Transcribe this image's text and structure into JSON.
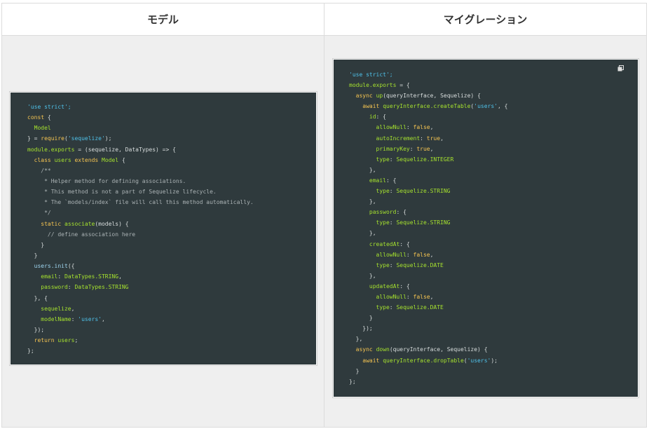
{
  "headers": {
    "model": "モデル",
    "migration": "マイグレーション"
  },
  "icons": {
    "copy": "copy-icon"
  },
  "colors": {
    "code_bg": "#2f3a3d",
    "string": "#4fc1e9",
    "keyword": "#f5c451",
    "attribute": "#a6e22e",
    "comment": "#aab2b4"
  },
  "model_code": [
    [
      [
        "str",
        "'use strict';"
      ]
    ],
    [
      [
        "kw",
        "const"
      ],
      [
        "pl",
        " {"
      ]
    ],
    [
      [
        "pl",
        "  "
      ],
      [
        "attr",
        "Model"
      ]
    ],
    [
      [
        "pl",
        "} = "
      ],
      [
        "kw",
        "require"
      ],
      [
        "pl",
        "("
      ],
      [
        "str",
        "'sequelize'"
      ],
      [
        "pl",
        ");"
      ]
    ],
    [
      [
        "attr",
        "module.exports"
      ],
      [
        "pl",
        " = (sequelize, DataTypes) => {"
      ]
    ],
    [
      [
        "pl",
        "  "
      ],
      [
        "kw",
        "class"
      ],
      [
        "pl",
        " "
      ],
      [
        "attr",
        "users"
      ],
      [
        "pl",
        " "
      ],
      [
        "kw",
        "extends"
      ],
      [
        "pl",
        " "
      ],
      [
        "attr",
        "Model"
      ],
      [
        "pl",
        " {"
      ]
    ],
    [
      [
        "cm",
        "    /**"
      ]
    ],
    [
      [
        "cm",
        "     * Helper method for defining associations."
      ]
    ],
    [
      [
        "cm",
        "     * This method is not a part of Sequelize lifecycle."
      ]
    ],
    [
      [
        "cm",
        "     * The `models/index` file will call this method automatically."
      ]
    ],
    [
      [
        "cm",
        "     */"
      ]
    ],
    [
      [
        "pl",
        "    "
      ],
      [
        "kw",
        "static"
      ],
      [
        "pl",
        " "
      ],
      [
        "attr",
        "associate"
      ],
      [
        "pl",
        "(models) {"
      ]
    ],
    [
      [
        "cm",
        "      // define association here"
      ]
    ],
    [
      [
        "pl",
        "    }"
      ]
    ],
    [
      [
        "pl",
        "  }"
      ]
    ],
    [
      [
        "pl",
        "  "
      ],
      [
        "fn",
        "users.init"
      ],
      [
        "pl",
        "({"
      ]
    ],
    [
      [
        "pl",
        "    "
      ],
      [
        "attr",
        "email"
      ],
      [
        "pl",
        ": "
      ],
      [
        "attr",
        "DataTypes.STRING"
      ],
      [
        "pl",
        ","
      ]
    ],
    [
      [
        "pl",
        "    "
      ],
      [
        "attr",
        "password"
      ],
      [
        "pl",
        ": "
      ],
      [
        "attr",
        "DataTypes.STRING"
      ]
    ],
    [
      [
        "pl",
        "  }, {"
      ]
    ],
    [
      [
        "pl",
        "    "
      ],
      [
        "attr",
        "sequelize"
      ],
      [
        "pl",
        ","
      ]
    ],
    [
      [
        "pl",
        "    "
      ],
      [
        "attr",
        "modelName"
      ],
      [
        "pl",
        ": "
      ],
      [
        "str",
        "'users'"
      ],
      [
        "pl",
        ","
      ]
    ],
    [
      [
        "pl",
        "  });"
      ]
    ],
    [
      [
        "pl",
        "  "
      ],
      [
        "kw",
        "return"
      ],
      [
        "pl",
        " "
      ],
      [
        "attr",
        "users"
      ],
      [
        "pl",
        ";"
      ]
    ],
    [
      [
        "pl",
        "};"
      ]
    ]
  ],
  "migration_code": [
    [
      [
        "str",
        "'use strict';"
      ]
    ],
    [
      [
        "attr",
        "module.exports"
      ],
      [
        "pl",
        " = {"
      ]
    ],
    [
      [
        "pl",
        "  "
      ],
      [
        "kw",
        "async"
      ],
      [
        "pl",
        " "
      ],
      [
        "attr",
        "up"
      ],
      [
        "pl",
        "(queryInterface, Sequelize) {"
      ]
    ],
    [
      [
        "pl",
        "    "
      ],
      [
        "kw",
        "await"
      ],
      [
        "pl",
        " "
      ],
      [
        "attr",
        "queryInterface.createTable"
      ],
      [
        "pl",
        "("
      ],
      [
        "str",
        "'users'"
      ],
      [
        "pl",
        ", {"
      ]
    ],
    [
      [
        "pl",
        "      "
      ],
      [
        "attr",
        "id"
      ],
      [
        "pl",
        ": {"
      ]
    ],
    [
      [
        "pl",
        "        "
      ],
      [
        "attr",
        "allowNull"
      ],
      [
        "pl",
        ": "
      ],
      [
        "kw",
        "false"
      ],
      [
        "pl",
        ","
      ]
    ],
    [
      [
        "pl",
        "        "
      ],
      [
        "attr",
        "autoIncrement"
      ],
      [
        "pl",
        ": "
      ],
      [
        "kw",
        "true"
      ],
      [
        "pl",
        ","
      ]
    ],
    [
      [
        "pl",
        "        "
      ],
      [
        "attr",
        "primaryKey"
      ],
      [
        "pl",
        ": "
      ],
      [
        "kw",
        "true"
      ],
      [
        "pl",
        ","
      ]
    ],
    [
      [
        "pl",
        "        "
      ],
      [
        "attr",
        "type"
      ],
      [
        "pl",
        ": "
      ],
      [
        "attr",
        "Sequelize.INTEGER"
      ]
    ],
    [
      [
        "pl",
        "      },"
      ]
    ],
    [
      [
        "pl",
        "      "
      ],
      [
        "attr",
        "email"
      ],
      [
        "pl",
        ": {"
      ]
    ],
    [
      [
        "pl",
        "        "
      ],
      [
        "attr",
        "type"
      ],
      [
        "pl",
        ": "
      ],
      [
        "attr",
        "Sequelize.STRING"
      ]
    ],
    [
      [
        "pl",
        "      },"
      ]
    ],
    [
      [
        "pl",
        "      "
      ],
      [
        "attr",
        "password"
      ],
      [
        "pl",
        ": {"
      ]
    ],
    [
      [
        "pl",
        "        "
      ],
      [
        "attr",
        "type"
      ],
      [
        "pl",
        ": "
      ],
      [
        "attr",
        "Sequelize.STRING"
      ]
    ],
    [
      [
        "pl",
        "      },"
      ]
    ],
    [
      [
        "pl",
        "      "
      ],
      [
        "attr",
        "createdAt"
      ],
      [
        "pl",
        ": {"
      ]
    ],
    [
      [
        "pl",
        "        "
      ],
      [
        "attr",
        "allowNull"
      ],
      [
        "pl",
        ": "
      ],
      [
        "kw",
        "false"
      ],
      [
        "pl",
        ","
      ]
    ],
    [
      [
        "pl",
        "        "
      ],
      [
        "attr",
        "type"
      ],
      [
        "pl",
        ": "
      ],
      [
        "attr",
        "Sequelize.DATE"
      ]
    ],
    [
      [
        "pl",
        "      },"
      ]
    ],
    [
      [
        "pl",
        "      "
      ],
      [
        "attr",
        "updatedAt"
      ],
      [
        "pl",
        ": {"
      ]
    ],
    [
      [
        "pl",
        "        "
      ],
      [
        "attr",
        "allowNull"
      ],
      [
        "pl",
        ": "
      ],
      [
        "kw",
        "false"
      ],
      [
        "pl",
        ","
      ]
    ],
    [
      [
        "pl",
        "        "
      ],
      [
        "attr",
        "type"
      ],
      [
        "pl",
        ": "
      ],
      [
        "attr",
        "Sequelize.DATE"
      ]
    ],
    [
      [
        "pl",
        "      }"
      ]
    ],
    [
      [
        "pl",
        "    });"
      ]
    ],
    [
      [
        "pl",
        "  },"
      ]
    ],
    [
      [
        "pl",
        "  "
      ],
      [
        "kw",
        "async"
      ],
      [
        "pl",
        " "
      ],
      [
        "attr",
        "down"
      ],
      [
        "pl",
        "(queryInterface, Sequelize) {"
      ]
    ],
    [
      [
        "pl",
        "    "
      ],
      [
        "kw",
        "await"
      ],
      [
        "pl",
        " "
      ],
      [
        "attr",
        "queryInterface.dropTable"
      ],
      [
        "pl",
        "("
      ],
      [
        "str",
        "'users'"
      ],
      [
        "pl",
        ");"
      ]
    ],
    [
      [
        "pl",
        "  }"
      ]
    ],
    [
      [
        "pl",
        "};"
      ]
    ]
  ]
}
